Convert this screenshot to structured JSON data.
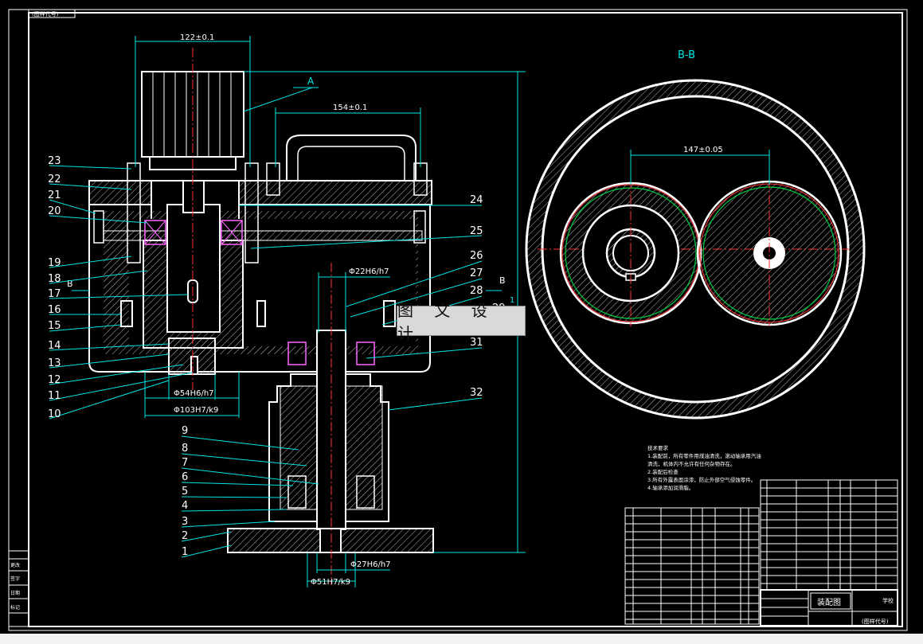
{
  "title_tab": "(图样代号)",
  "section_label": "B-B",
  "view_label_b": "B",
  "leader_a": "A",
  "watermark": "图 文 设 计",
  "dims": {
    "d122": "122±0.1",
    "d154": "154±0.1",
    "d147": "147±0.05",
    "phi2296": "Φ22H6/h7",
    "phi5496": "Φ54H6/h7",
    "phi103": "Φ103H7/k9",
    "phi2796": "Φ27H6/h7",
    "phi51": "Φ51H7/k9",
    "vert": "1"
  },
  "part_numbers_left": [
    "23",
    "22",
    "21",
    "20",
    "19",
    "18",
    "17",
    "16",
    "15",
    "14",
    "13",
    "12",
    "11",
    "10",
    "9",
    "8",
    "7",
    "6",
    "5",
    "4",
    "3",
    "2",
    "1"
  ],
  "part_numbers_right": [
    "24",
    "25",
    "26",
    "27",
    "28",
    "29",
    "31",
    "32"
  ],
  "notes_title": "技术要求",
  "notes": [
    "1.装配前，所有零件用煤油清洗，滚动轴承用汽油",
    "清洗，机体内不允许有任何杂物存在。",
    "2.装配后检查",
    "3.所有外露表面涂漆，防止外部空气侵蚀零件。",
    "4.轴承添加润滑脂。"
  ],
  "title_block": {
    "drawing_name": "装配图",
    "school": "学校",
    "drawing_code": "(图样代号)"
  },
  "side_block": [
    "更改",
    "签字",
    "日期",
    "标记"
  ]
}
